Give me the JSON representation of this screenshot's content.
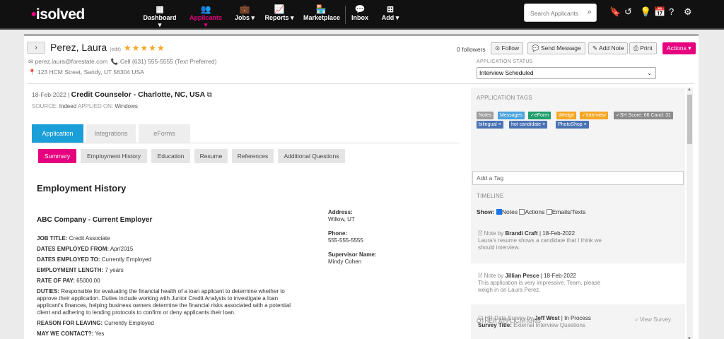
{
  "brand": {
    "logo": "isolved",
    "accent": "#e6007e",
    "tab_blue": "#1a9fd9"
  },
  "nav": {
    "items": [
      {
        "label": "Dashboard ▾",
        "icon": "dashboard-icon"
      },
      {
        "label": "Applicants ▾",
        "icon": "users-icon"
      },
      {
        "label": "Jobs ▾",
        "icon": "briefcase-icon"
      },
      {
        "label": "Reports ▾",
        "icon": "chart-icon"
      },
      {
        "label": "Marketplace",
        "icon": "store-icon"
      },
      {
        "label": "Inbox",
        "icon": "inbox-icon"
      },
      {
        "label": "Add ▾",
        "icon": "plus-square-icon"
      }
    ],
    "search_placeholder": "Search Applicants"
  },
  "applicant": {
    "name": "Perez, Laura",
    "edit": "(edit)",
    "stars": "★★★★★",
    "email": "perez.laura@forestate.com",
    "phone": "Cell (631) 555-5555 (Text Preferred)",
    "address": "123 HCM Street, Sandy, UT 56304 USA",
    "followers": "0 followers"
  },
  "actions": {
    "follow": "Follow",
    "send_message": "Send Message",
    "add_note": "Add Note",
    "print": "Print",
    "actions": "Actions ▾"
  },
  "status": {
    "label": "APPLICATION STATUS",
    "value": "Interview Scheduled"
  },
  "job": {
    "date": "18-Feb-2022 |",
    "title": "Credit Counselor - Charlotte, NC, USA",
    "source_label": "SOURCE:",
    "source": "Indeed",
    "applied_label": "APPLIED ON:",
    "applied_on": "Windows"
  },
  "tabs": [
    "Application",
    "Integrations",
    "eForms"
  ],
  "subtabs": [
    "Summary",
    "Employment History",
    "Education",
    "Resume",
    "References",
    "Additional Questions"
  ],
  "employment": {
    "section_title": "Employment History",
    "employer": "ABC Company - Current Employer",
    "job_title_label": "JOB TITLE:",
    "job_title": "Credit Associate",
    "from_label": "DATES EMPLOYED FROM:",
    "from": "Apr/2015",
    "to_label": "DATES EMPLOYED TO:",
    "to": "Currently Employed",
    "length_label": "EMPLOYMENT LENGTH:",
    "length": "7 years",
    "pay_label": "RATE OF PAY:",
    "pay": "65000.00",
    "duties_label": "DUTIES:",
    "duties_1": "Responsible for evaluating the financial health of a loan applicant to determine whether to",
    "duties_2": "approve their application. Duties include working with Junior Credit Analysts to investigate a loan",
    "duties_3": "applicant's finances, helping business owners determine the financial risks associated with a potential",
    "duties_4": "client and adhering to lending protocols to confirm or deny applicants their loan.",
    "reason_label": "REASON FOR LEAVING:",
    "reason": "Currently Employed",
    "contact_label": "MAY WE CONTACT?:",
    "contact": "Yes",
    "address_label": "Address:",
    "address": "Willow, UT",
    "phone_label": "Phone:",
    "phone": "555-555-5555",
    "supervisor_label": "Supervisor Name:",
    "supervisor": "Mindy Cohen"
  },
  "tags": {
    "label": "APPLICATION TAGS",
    "row1": [
      {
        "text": "Notes",
        "color": "#9e9e9e"
      },
      {
        "text": "Messages",
        "color": "#4aa3df"
      },
      {
        "text": "✓eForm",
        "color": "#1e9e6a"
      },
      {
        "text": "Wedge",
        "color": "#f5a623"
      },
      {
        "text": "✓Interview",
        "color": "#f5a623"
      },
      {
        "text": "✓SH Score: 66 Cand: 31",
        "color": "#8a8a8a"
      }
    ],
    "row2": [
      {
        "text": "bilingual ×",
        "color": "#4a73b5"
      },
      {
        "text": "hot candidate ×",
        "color": "#4a73b5"
      },
      {
        "text": "PhotoShop ×",
        "color": "#4a73b5"
      }
    ],
    "add_placeholder": "Add a Tag"
  },
  "timeline": {
    "label": "TIMELINE",
    "show": "Show:",
    "notes": "Notes",
    "actions": "Actions",
    "emails": "Emails/Texts",
    "items": [
      {
        "prefix": "Note by",
        "author": "Brandi Craft",
        "date": "| 18-Feb-2022",
        "line1": "Laura's resume shows a candidate that I think we",
        "line2": "should interview."
      },
      {
        "prefix": "Note by",
        "author": "Jillian Pesce",
        "date": "| 18-Feb-2022",
        "line1": "This application is very impressive. Team, please",
        "line2": "weigh in on Laura Perez."
      }
    ],
    "survey": {
      "prefix": "HR Data Survey by",
      "author": "Jeff West",
      "status": "| In Process",
      "title_label": "Survey Title:",
      "title": "External Interview Questions",
      "view": "View Survey"
    },
    "other_label": "OTHER APPLICATIONS"
  }
}
